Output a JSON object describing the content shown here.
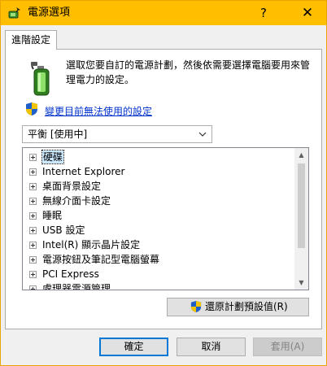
{
  "window": {
    "title": "電源選項",
    "help_glyph": "?",
    "close_glyph": "✕",
    "title_bar_color": "#ffbf00"
  },
  "tab": {
    "label": "進階設定"
  },
  "description": "選取您要自訂的電源計劃，然後依需要選擇電腦要用來管理電力的設定。",
  "change_link": {
    "label": "變更目前無法使用的設定",
    "color": "#0033cc"
  },
  "plan_select": {
    "value": "平衡 [使用中]"
  },
  "tree": {
    "items": [
      {
        "label": "硬碟",
        "selected": true
      },
      {
        "label": "Internet Explorer"
      },
      {
        "label": "桌面背景設定"
      },
      {
        "label": "無線介面卡設定"
      },
      {
        "label": "睡眠"
      },
      {
        "label": "USB 設定"
      },
      {
        "label": "Intel(R) 顯示晶片設定"
      },
      {
        "label": "電源按鈕及筆記型電腦螢幕"
      },
      {
        "label": "PCI Express"
      },
      {
        "label": "處理器電源管理"
      }
    ]
  },
  "restore_button": {
    "label": "還原計劃預設值(R)"
  },
  "footer": {
    "ok": "確定",
    "cancel": "取消",
    "apply": "套用(A)"
  },
  "icons": {
    "app": "power-options-icon",
    "battery": "battery-plug-icon",
    "shield": "uac-shield-icon"
  }
}
